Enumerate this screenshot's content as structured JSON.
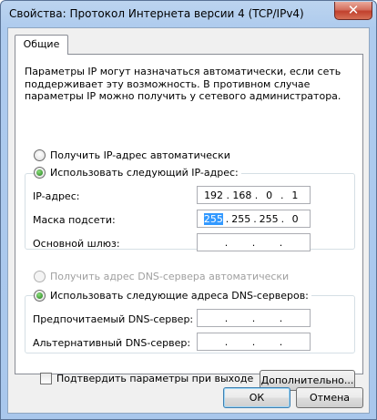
{
  "window": {
    "title": "Свойства: Протокол Интернета версии 4 (TCP/IPv4)",
    "close_glyph": "✕"
  },
  "tabs": [
    {
      "label": "Общие",
      "active": true
    }
  ],
  "description": "Параметры IP могут назначаться автоматически, если сеть поддерживает эту возможность. В противном случае параметры IP можно получить у сетевого администратора.",
  "ip_section": {
    "auto_label": "Получить IP-адрес автоматически",
    "manual_label": "Использовать следующий IP-адрес:",
    "selected": "manual",
    "fields": [
      {
        "label": "IP-адрес:",
        "octets": [
          "192",
          "168",
          "0",
          "1"
        ]
      },
      {
        "label": "Маска подсети:",
        "octets": [
          "255",
          "255",
          "255",
          "0"
        ],
        "selected_octet": 0
      },
      {
        "label": "Основной шлюз:",
        "octets": [
          "",
          "",
          "",
          ""
        ]
      }
    ]
  },
  "dns_section": {
    "auto_label": "Получить адрес DNS-сервера автоматически",
    "manual_label": "Использовать следующие адреса DNS-серверов:",
    "selected": "manual",
    "fields": [
      {
        "label": "Предпочитаемый DNS-сервер:",
        "octets": [
          "",
          "",
          "",
          ""
        ]
      },
      {
        "label": "Альтернативный DNS-сервер:",
        "octets": [
          "",
          "",
          "",
          ""
        ]
      }
    ]
  },
  "validate_on_exit": {
    "label": "Подтвердить параметры при выходе",
    "checked": false
  },
  "buttons": {
    "advanced": "Дополнительно...",
    "ok": "ОК",
    "cancel": "Отмена"
  },
  "colors": {
    "selection": "#3399ff",
    "title_bar": "#aecbee",
    "close_button": "#c1402d"
  }
}
